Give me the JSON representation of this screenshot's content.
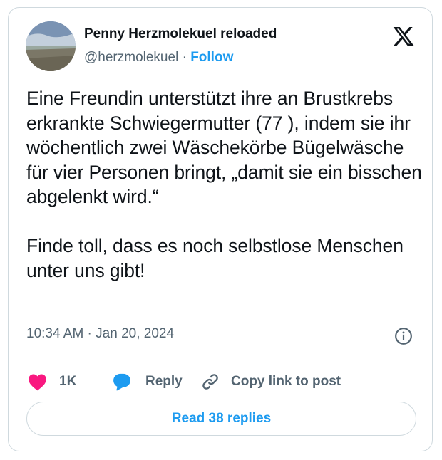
{
  "author": {
    "name": "Penny Herzmolekuel reloaded",
    "handle": "@herzmolekuel",
    "separator": "·",
    "follow_label": "Follow"
  },
  "post": {
    "text": "Eine Freundin unterstützt ihre an Brustkrebs erkrankte Schwiegermutter (77 ), indem sie ihr wöchentlich zwei Wäschekörbe Bügelwäsche für vier Personen bringt, „damit sie ein bisschen abgelenkt wird.“\n\nFinde toll, dass es noch selbstlose Menschen unter uns gibt!",
    "timestamp": "10:34 AM · Jan 20, 2024"
  },
  "actions": {
    "like_count": "1K",
    "reply_label": "Reply",
    "copy_label": "Copy link to post"
  },
  "footer": {
    "read_replies_label": "Read 38 replies"
  },
  "icons": {
    "brand": "x-logo-icon",
    "info": "info-icon",
    "like": "heart-icon",
    "reply": "speech-bubble-icon",
    "copy": "link-icon"
  },
  "colors": {
    "accent": "#1d9bf0",
    "like": "#f91880",
    "secondary_text": "#536471",
    "border": "#cfd9de"
  }
}
